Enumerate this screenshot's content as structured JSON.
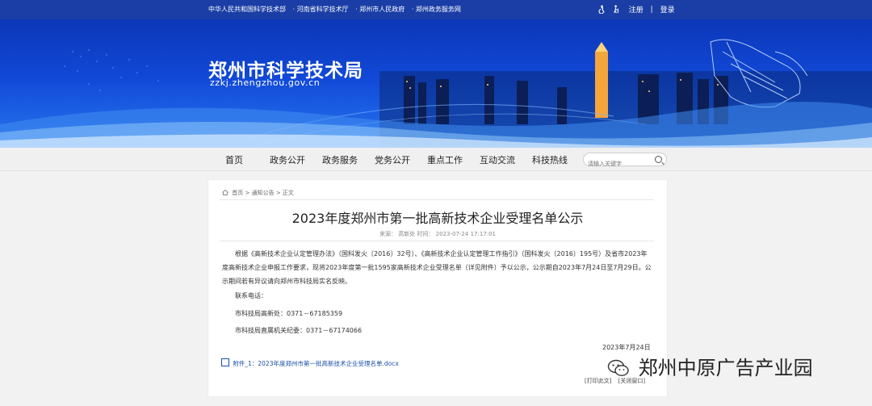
{
  "topbar": {
    "links": [
      "中华人民共和国科学技术部",
      "· 河南省科学技术厅",
      "· 郑州市人民政府",
      "· 郑州政务服务网"
    ],
    "accessibility_icon": "accessibility-icon",
    "elder_icon": "elder-mode-icon",
    "register_label": "注册",
    "separator": "|",
    "login_label": "登录"
  },
  "banner": {
    "title": "郑州市科学技术局",
    "domain": "zzkj.zhengzhou.gov.cn"
  },
  "nav": {
    "items": [
      "首页",
      "政务公开",
      "政务服务",
      "党务公开",
      "重点工作",
      "互动交流",
      "科技热线"
    ],
    "search_placeholder": "请输入关键字"
  },
  "article": {
    "breadcrumb": {
      "home": "首页",
      "sep1": ">",
      "section": "通知公告",
      "sep2": ">",
      "current": "正文"
    },
    "title": "2023年度郑州市第一批高新技术企业受理名单公示",
    "meta": "来源：  高新处  时间：  2023-07-24 17:17:01",
    "body": "根据《高新技术企业认定管理办法》（国科发火〔2016〕32号）、《高新技术企业认定管理工作指引》（国科发火〔2016〕195号）及省市2023年度高新技术企业申报工作要求，现将2023年度第一批1595家高新技术企业受理名单（详见附件）予以公示，公示期自2023年7月24日至7月29日。公示期间若有异议请向郑州市科技局实名反映。",
    "contact_label": "联系电话：",
    "contact_1": "市科技局高新处：0371－67185359",
    "contact_2": "市科技局直属机关纪委：0371－67174066",
    "date": "2023年7月24日",
    "attachment": "附件_1：2023年度郑州市第一批高新技术企业受理名单.docx",
    "print_label": "[打印此文]",
    "close_label": "[关闭窗口]"
  },
  "watermark": {
    "text": "郑州中原广告产业园"
  },
  "colors": {
    "topbar": "#1a3ea6",
    "banner": "#1148d6",
    "link": "#1a4fa8"
  }
}
